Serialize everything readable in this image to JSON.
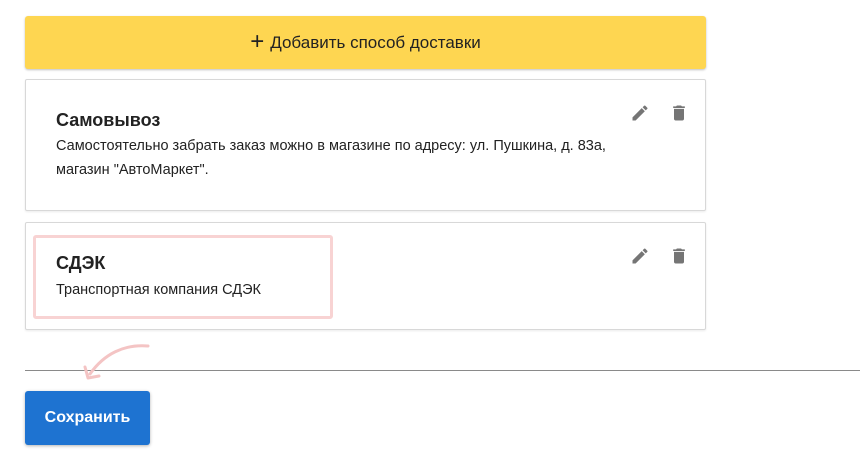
{
  "toolbar": {
    "add_label": "Добавить способ доставки"
  },
  "methods": [
    {
      "title": "Самовывоз",
      "description": "Самостоятельно забрать заказ можно в магазине по адресу: ул. Пушкина, д. 83а, магазин \"АвтоМаркет\"."
    },
    {
      "title": "СДЭК",
      "description": "Транспортная компания СДЭК"
    }
  ],
  "footer": {
    "save_label": "Сохранить"
  },
  "icons": {
    "add": "plus-icon",
    "edit": "pencil-icon",
    "delete": "trash-icon"
  },
  "colors": {
    "add_button_bg": "#fed651",
    "save_button_bg": "#1e73d1",
    "highlight": "#f8d3d3",
    "icon": "#757575"
  }
}
